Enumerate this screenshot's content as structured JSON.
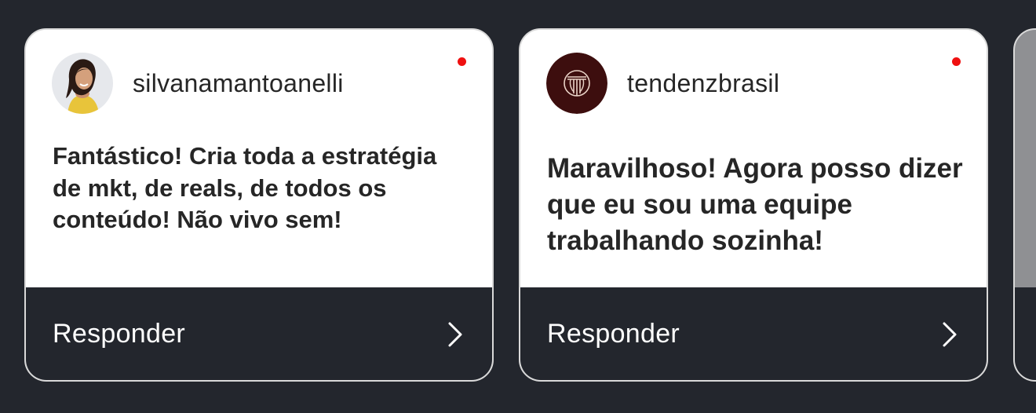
{
  "cards": [
    {
      "username": "silvanamantoanelli",
      "message": "Fantástico! Cria toda a estratégia de mkt, de reals, de todos os conteúdo! Não vivo sem!",
      "reply_label": "Responder",
      "avatar_icon": "profile-photo",
      "unread": true
    },
    {
      "username": "tendenzbrasil",
      "message": "Maravilhoso! Agora posso dizer que eu sou uma equipe trabalhando sozinha!",
      "reply_label": "Responder",
      "avatar_icon": "brand-logo",
      "unread": true
    }
  ],
  "colors": {
    "background": "#23262d",
    "card": "#ffffff",
    "text": "#262626",
    "unread_dot": "#ef1010",
    "logo_bg": "#3d0e0e",
    "logo_fg": "#e9d2c6"
  }
}
